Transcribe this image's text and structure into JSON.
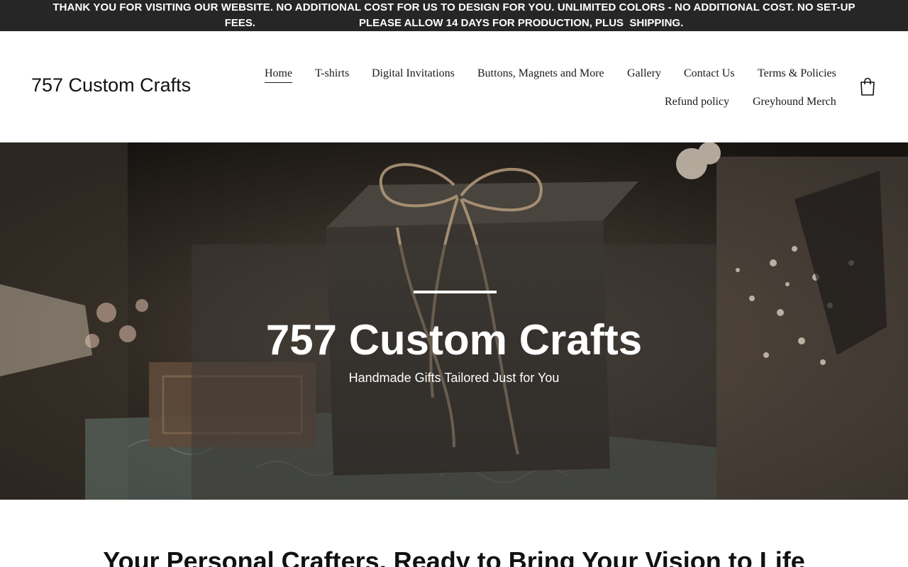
{
  "announcement": {
    "line1": "THANK YOU FOR VISITING OUR WEBSITE.   NO ADDITIONAL COST FOR US TO DESIGN FOR YOU.    UNLIMITED COLORS - NO ADDITIONAL COST.   NO SET-UP",
    "line2": "FEES.                                   PLEASE ALLOW 14 DAYS FOR PRODUCTION, PLUS  SHIPPING."
  },
  "header": {
    "site_title": "757 Custom Crafts",
    "nav": {
      "home": "Home",
      "tshirts": "T-shirts",
      "digital_invitations": "Digital Invitations",
      "buttons_magnets": "Buttons, Magnets and More",
      "gallery": "Gallery",
      "contact": "Contact Us",
      "terms": "Terms & Policies",
      "refund": "Refund policy",
      "greyhound": "Greyhound Merch"
    },
    "active_nav": "Home",
    "cart_icon": "shopping-bag-icon"
  },
  "hero": {
    "title": "757 Custom Crafts",
    "subtitle": "Handmade Gifts Tailored Just for You"
  },
  "section": {
    "heading": "Your Personal Crafters, Ready to Bring Your Vision to Life"
  },
  "colors": {
    "announcement_bg": "#262626",
    "text": "#111111",
    "hero_text": "#ffffff"
  }
}
